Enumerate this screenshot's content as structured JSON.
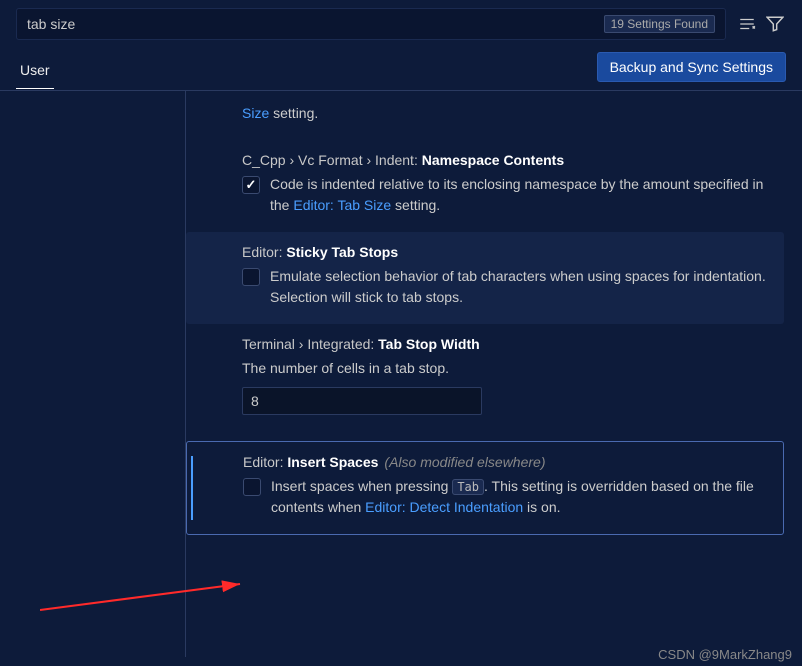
{
  "search": {
    "value": "tab size",
    "found_badge": "19 Settings Found"
  },
  "tabs": {
    "user": "User"
  },
  "sync_button": "Backup and Sync Settings",
  "settings": {
    "partial_top": {
      "link": "Size",
      "suffix": " setting."
    },
    "namespace": {
      "prefix": "C_Cpp › Vc Format › Indent: ",
      "title": "Namespace Contents",
      "desc_a": "Code is indented relative to its enclosing namespace by the amount specified in the ",
      "desc_link": "Editor: Tab Size",
      "desc_b": " setting."
    },
    "sticky": {
      "prefix": "Editor: ",
      "title": "Sticky Tab Stops",
      "desc": "Emulate selection behavior of tab characters when using spaces for indentation. Selection will stick to tab stops."
    },
    "terminal": {
      "prefix": "Terminal › Integrated: ",
      "title": "Tab Stop Width",
      "desc": "The number of cells in a tab stop.",
      "value": "8"
    },
    "insert_spaces": {
      "prefix": "Editor: ",
      "title": "Insert Spaces",
      "modified": "(Also modified elsewhere)",
      "desc_a": "Insert spaces when pressing ",
      "kbd": "Tab",
      "desc_b": ". This setting is overridden based on the file contents when ",
      "desc_link": "Editor: Detect Indentation",
      "desc_c": " is on."
    }
  },
  "watermark": "CSDN @9MarkZhang9"
}
